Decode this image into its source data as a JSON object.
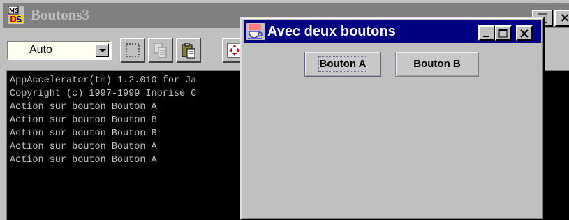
{
  "console_window": {
    "title": "Boutons3",
    "caption_buttons": [
      "□",
      "×"
    ],
    "toolbar": {
      "font_select": {
        "value": "Auto"
      },
      "tools": [
        "mark-icon",
        "copy-icon",
        "paste-icon",
        "scroll-icon"
      ]
    },
    "output_lines": [
      "AppAccelerator(tm) 1.2.010 for Ja",
      "Copyright (c) 1997-1999 Inprise C",
      "Action sur bouton Bouton A",
      "Action sur bouton Bouton B",
      "Action sur bouton Bouton B",
      "Action sur bouton Bouton A",
      "Action sur bouton Bouton A"
    ]
  },
  "dialog": {
    "title": "Avec deux boutons",
    "caption_buttons": [
      "minimize-icon",
      "maximize-icon",
      "close-icon"
    ],
    "buttons": {
      "a_label": "Bouton A",
      "b_label": "Bouton B"
    }
  },
  "colors": {
    "active_title": "#000080",
    "inactive_title": "#808080",
    "console_bg": "#000000",
    "console_text": "#c0c0c0"
  }
}
